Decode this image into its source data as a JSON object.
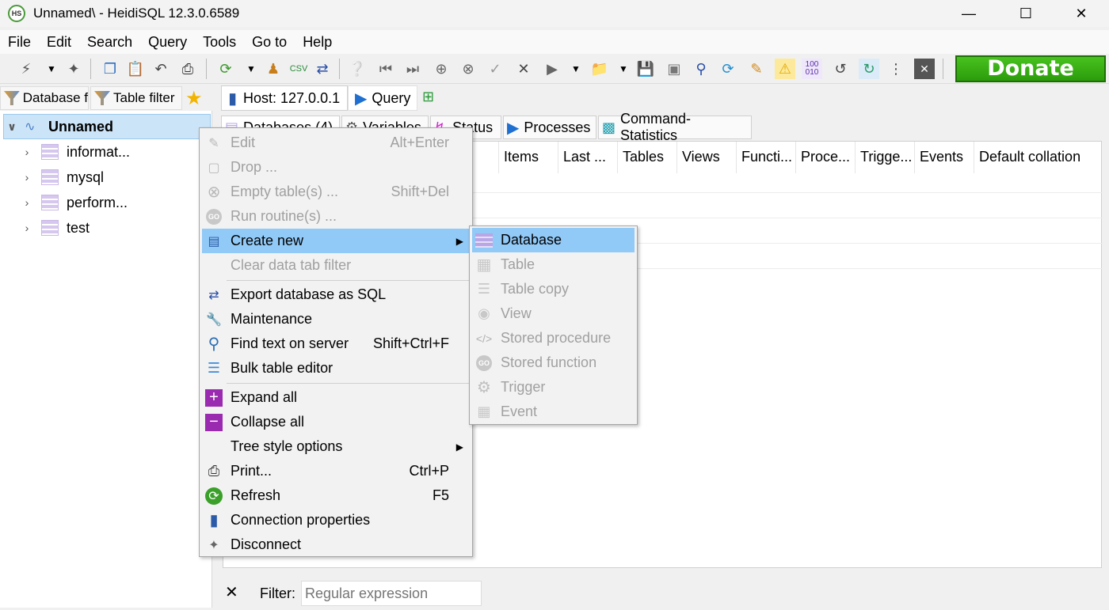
{
  "window": {
    "title": "Unnamed\\ - HeidiSQL 12.3.0.6589",
    "icon_text": "HS"
  },
  "menubar": [
    "File",
    "Edit",
    "Search",
    "Query",
    "Tools",
    "Go to",
    "Help"
  ],
  "donate_label": "Donate",
  "left_panel": {
    "tabs": [
      "Database f",
      "Table filter"
    ],
    "tree": {
      "root": "Unnamed",
      "children": [
        "informat...",
        "mysql",
        "perform...",
        "test"
      ]
    }
  },
  "right_panel": {
    "host_tabs": [
      "Host: 127.0.0.1",
      "Query"
    ],
    "sub_tabs": [
      "Databases (4)",
      "Variables",
      "Status",
      "Processes",
      "Command-Statistics"
    ],
    "columns": [
      "Items",
      "Last ...",
      "Tables",
      "Views",
      "Functi...",
      "Proce...",
      "Trigge...",
      "Events",
      "Default collation"
    ]
  },
  "filter_bar": {
    "label": "Filter:",
    "placeholder": "Regular expression"
  },
  "context_menu": [
    {
      "label": "Edit",
      "shortcut": "Alt+Enter",
      "disabled": true,
      "icon": "pencil-icon"
    },
    {
      "label": "Drop ...",
      "shortcut": "",
      "disabled": true,
      "icon": "drop-icon"
    },
    {
      "label": "Empty table(s) ...",
      "shortcut": "Shift+Del",
      "disabled": true,
      "icon": "empty-icon"
    },
    {
      "label": "Run routine(s) ...",
      "shortcut": "",
      "disabled": true,
      "icon": "go-icon"
    },
    {
      "label": "Create new",
      "shortcut": "",
      "disabled": false,
      "icon": "create-new-icon",
      "submenu": true,
      "highlighted": true
    },
    {
      "label": "Clear data tab filter",
      "shortcut": "",
      "disabled": true,
      "icon": ""
    },
    {
      "label": "Export database as SQL",
      "shortcut": "",
      "disabled": false,
      "icon": "export-icon"
    },
    {
      "label": "Maintenance",
      "shortcut": "",
      "disabled": false,
      "icon": "wrench-icon"
    },
    {
      "label": "Find text on server",
      "shortcut": "Shift+Ctrl+F",
      "disabled": false,
      "icon": "magnifier-icon"
    },
    {
      "label": "Bulk table editor",
      "shortcut": "",
      "disabled": false,
      "icon": "layers-icon"
    },
    {
      "label": "Expand all",
      "shortcut": "",
      "disabled": false,
      "icon": "plus-icon"
    },
    {
      "label": "Collapse all",
      "shortcut": "",
      "disabled": false,
      "icon": "minus-icon"
    },
    {
      "label": "Tree style options",
      "shortcut": "",
      "disabled": false,
      "icon": "",
      "submenu": true
    },
    {
      "label": "Print...",
      "shortcut": "Ctrl+P",
      "disabled": false,
      "icon": "printer-icon"
    },
    {
      "label": "Refresh",
      "shortcut": "F5",
      "disabled": false,
      "icon": "refresh-icon"
    },
    {
      "label": "Connection properties",
      "shortcut": "",
      "disabled": false,
      "icon": "server-icon"
    },
    {
      "label": "Disconnect",
      "shortcut": "",
      "disabled": false,
      "icon": "disconnect-icon"
    }
  ],
  "submenu": [
    {
      "label": "Database",
      "disabled": false,
      "highlighted": true,
      "icon": "database-icon"
    },
    {
      "label": "Table",
      "disabled": true,
      "icon": "table-icon"
    },
    {
      "label": "Table copy",
      "disabled": true,
      "icon": "table-copy-icon"
    },
    {
      "label": "View",
      "disabled": true,
      "icon": "view-icon"
    },
    {
      "label": "Stored procedure",
      "disabled": true,
      "icon": "code-icon"
    },
    {
      "label": "Stored function",
      "disabled": true,
      "icon": "go-icon"
    },
    {
      "label": "Trigger",
      "disabled": true,
      "icon": "gear-icon"
    },
    {
      "label": "Event",
      "disabled": true,
      "icon": "calendar-icon"
    }
  ]
}
